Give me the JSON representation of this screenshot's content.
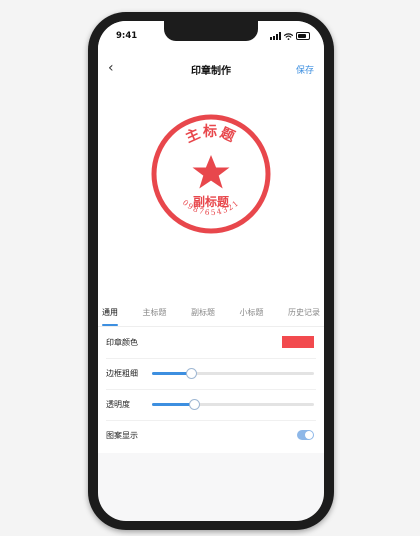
{
  "status_bar": {
    "time": "9:41"
  },
  "nav": {
    "back_icon": "chevron-left-icon",
    "title": "印章制作",
    "save_label": "保存"
  },
  "stamp": {
    "main_title": "主标题",
    "subtitle": "副标题",
    "number": "0987654321",
    "color": "#e8474c",
    "center_icon": "star-icon"
  },
  "tabs": [
    {
      "label": "通用",
      "active": true
    },
    {
      "label": "主标题",
      "active": false
    },
    {
      "label": "副标题",
      "active": false
    },
    {
      "label": "小标题",
      "active": false
    },
    {
      "label": "历史记录",
      "active": false
    }
  ],
  "settings": {
    "color_label": "印章颜色",
    "color_value": "#f24a4e",
    "border_label": "边框粗细",
    "border_value": 0.24,
    "opacity_label": "透明度",
    "opacity_value": 0.26,
    "pattern_label": "图案显示",
    "pattern_on": true
  },
  "colors": {
    "accent": "#3d8fe0"
  }
}
